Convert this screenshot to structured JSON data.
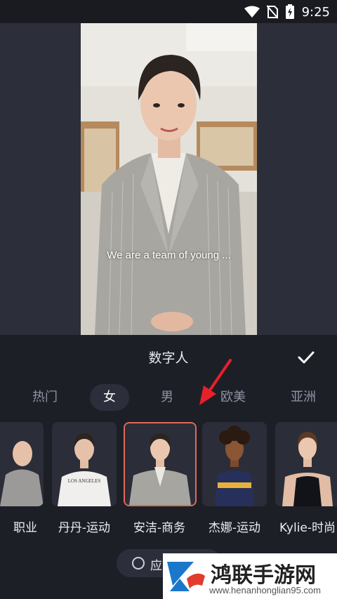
{
  "status_bar": {
    "time": "9:25"
  },
  "preview": {
    "subtitle": "We are a team of young ..."
  },
  "panel": {
    "title": "数字人",
    "tabs": [
      {
        "label": "热门"
      },
      {
        "label": "女"
      },
      {
        "label": "男"
      },
      {
        "label": "欧美"
      },
      {
        "label": "亚洲"
      }
    ],
    "active_tab": "女",
    "avatars": [
      {
        "label": "职业"
      },
      {
        "label": "丹丹-运动",
        "shirt_text": "LOS ANGELES"
      },
      {
        "label": "安洁-商务"
      },
      {
        "label": "杰娜-运动"
      },
      {
        "label": "Kylie-时尚"
      }
    ],
    "selected_avatar": "安洁-商务",
    "apply_label": "应"
  },
  "watermark": {
    "title": "鸿联手游网",
    "url": "www.henanhonglian95.com"
  },
  "colors": {
    "accent_selection": "#e06a5a",
    "arrow": "#e8202a",
    "panel_bg": "#1d1f27"
  }
}
